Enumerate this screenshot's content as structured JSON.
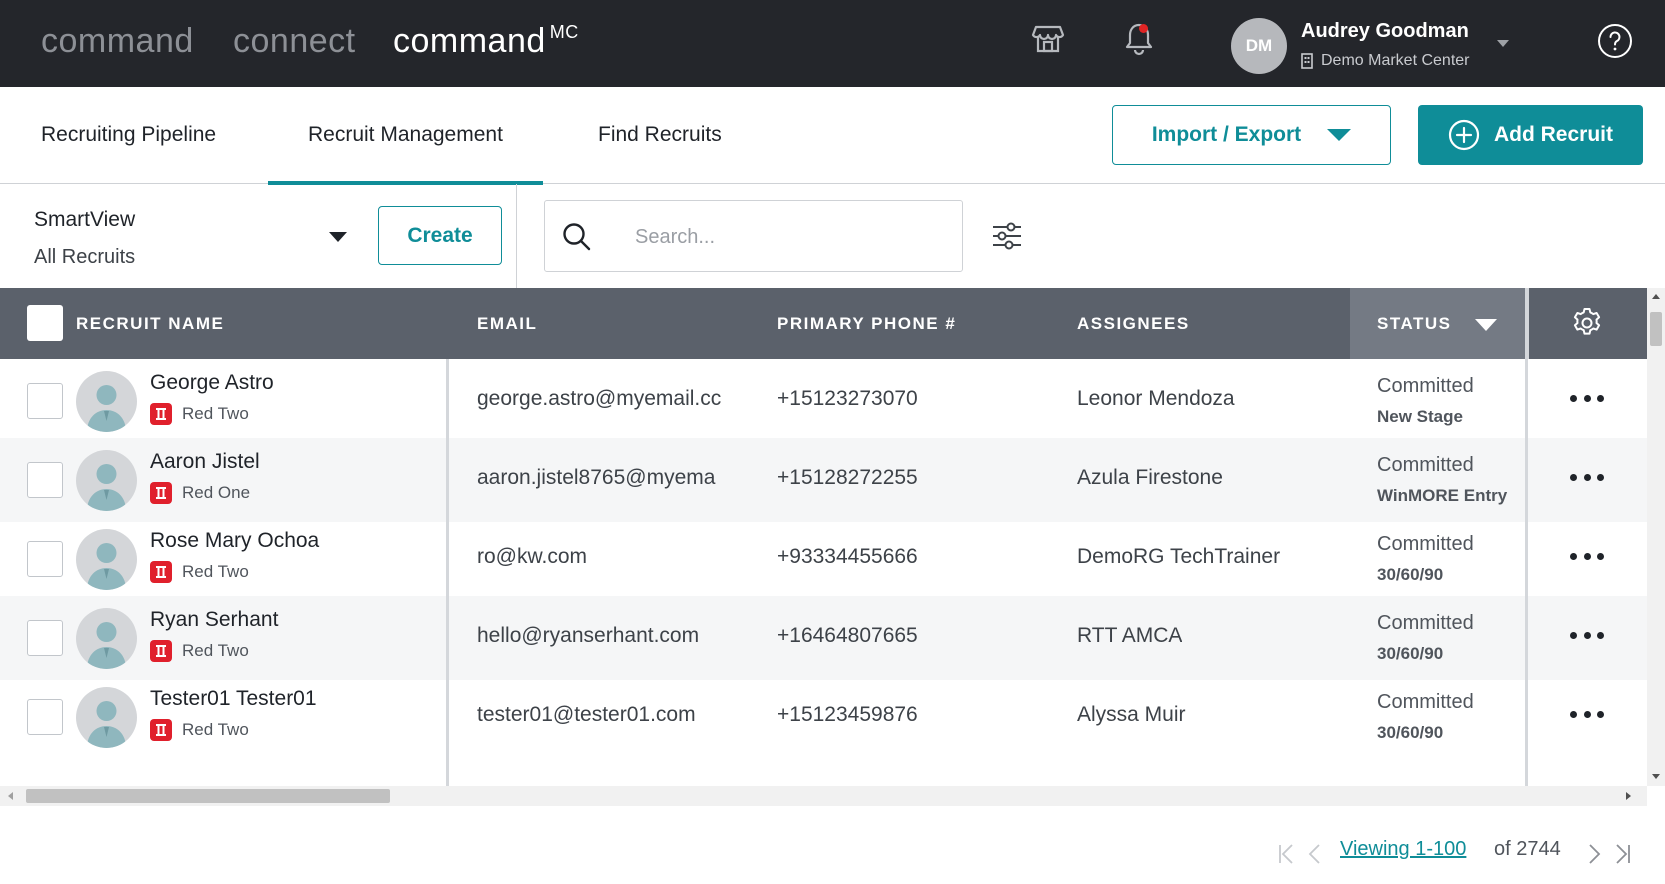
{
  "nav": {
    "brand_items": [
      "command",
      "connect",
      "command"
    ],
    "brand_superscript": "MC",
    "user_initials": "DM",
    "user_name": "Audrey Goodman",
    "user_org": "Demo Market Center"
  },
  "tabs": [
    {
      "label": "Recruiting Pipeline"
    },
    {
      "label": "Recruit Management",
      "active": true
    },
    {
      "label": "Find Recruits"
    }
  ],
  "actions": {
    "import_export_label": "Import / Export",
    "add_recruit_label": "Add Recruit"
  },
  "toolbar": {
    "smartview_label": "SmartView",
    "smartview_value": "All Recruits",
    "create_label": "Create",
    "search_placeholder": "Search...",
    "search_value": ""
  },
  "table": {
    "headers": {
      "name": "RECRUIT NAME",
      "email": "EMAIL",
      "phone": "PRIMARY PHONE #",
      "assignees": "ASSIGNEES",
      "status": "STATUS"
    },
    "rows": [
      {
        "name": "George Astro",
        "team": "Red Two",
        "email": "george.astro@myemail.cc",
        "phone": "+15123273070",
        "assignee": "Leonor Mendoza",
        "status": "Committed",
        "stage": "New Stage"
      },
      {
        "name": "Aaron Jistel",
        "team": "Red One",
        "email": "aaron.jistel8765@myema",
        "phone": "+15128272255",
        "assignee": "Azula Firestone",
        "status": "Committed",
        "stage": "WinMORE Entry"
      },
      {
        "name": "Rose Mary Ochoa",
        "team": "Red Two",
        "email": "ro@kw.com",
        "phone": "+93334455666",
        "assignee": "DemoRG TechTrainer",
        "status": "Committed",
        "stage": "30/60/90"
      },
      {
        "name": "Ryan Serhant",
        "team": "Red Two",
        "email": "hello@ryanserhant.com",
        "phone": "+16464807665",
        "assignee": "RTT AMCA",
        "status": "Committed",
        "stage": "30/60/90"
      },
      {
        "name": "Tester01 Tester01",
        "team": "Red Two",
        "email": "tester01@tester01.com",
        "phone": "+15123459876",
        "assignee": "Alyssa Muir",
        "status": "Committed",
        "stage": "30/60/90"
      }
    ]
  },
  "pagination": {
    "viewing": "Viewing 1-100",
    "total": "of 2744"
  },
  "colors": {
    "accent": "#0f8d98",
    "topbar": "#24262b",
    "table_header": "#5b616b",
    "badge_red": "#e0202c"
  },
  "icons": [
    "store-icon",
    "bell-icon",
    "building-icon",
    "help-icon",
    "plus-circle-icon",
    "search-icon",
    "filter-icon",
    "gear-icon",
    "more-icon"
  ]
}
